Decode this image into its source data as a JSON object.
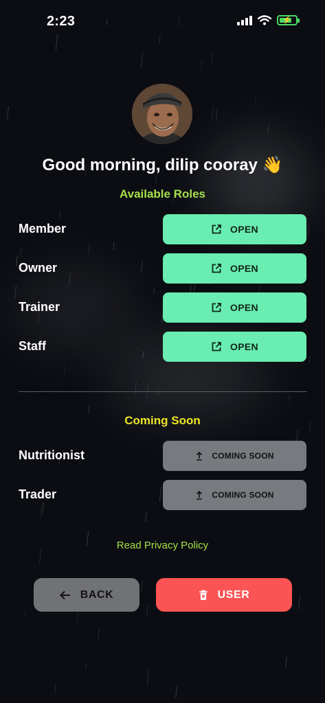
{
  "status_bar": {
    "time": "2:23",
    "battery_level": 0.78
  },
  "profile": {
    "greeting": "Good morning, dilip cooray 👋"
  },
  "available_roles": {
    "title": "Available Roles",
    "items": [
      {
        "label": "Member",
        "button_label": "OPEN",
        "icon": "open-in-new-icon"
      },
      {
        "label": "Owner",
        "button_label": "OPEN",
        "icon": "open-in-new-icon"
      },
      {
        "label": "Trainer",
        "button_label": "OPEN",
        "icon": "open-in-new-icon"
      },
      {
        "label": "Staff",
        "button_label": "OPEN",
        "icon": "open-in-new-icon"
      }
    ]
  },
  "coming_soon": {
    "title": "Coming Soon",
    "items": [
      {
        "label": "Nutritionist",
        "button_label": "COMING SOON",
        "icon": "upload-arrow-icon"
      },
      {
        "label": "Trader",
        "button_label": "COMING SOON",
        "icon": "upload-arrow-icon"
      }
    ]
  },
  "privacy_link": "Read Privacy Policy",
  "footer": {
    "back_label": "BACK",
    "back_icon": "arrow-left-icon",
    "user_label": "USER",
    "user_icon": "trash-icon"
  },
  "colors": {
    "background": "#0b0d12",
    "open_button": "#69edb1",
    "coming_soon_button": "#777a7e",
    "available_title": "#a6e04a",
    "coming_soon_title": "#f0e528",
    "back_button": "#707276",
    "user_button": "#fb5454",
    "battery": "#4cd964"
  }
}
